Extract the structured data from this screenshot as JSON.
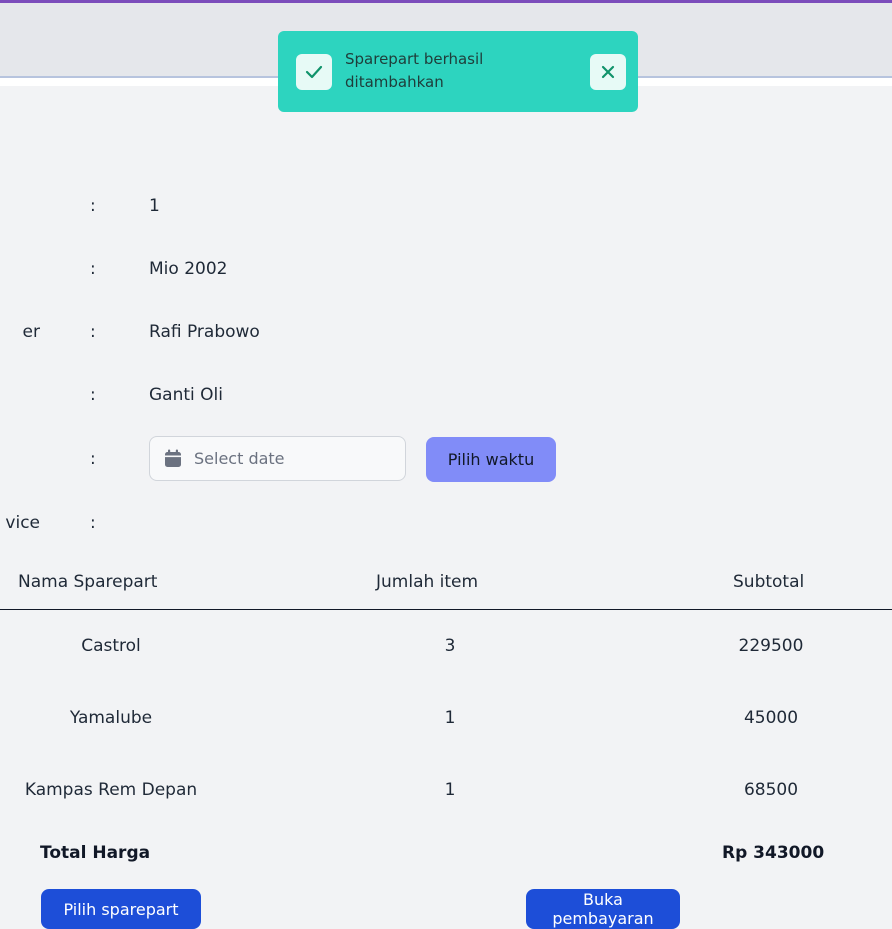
{
  "toast": {
    "message": "Sparepart berhasil ditambahkan",
    "icon": "check-icon",
    "close_icon": "close-icon",
    "color": "#2dd4bf"
  },
  "details": [
    {
      "label": "",
      "value": "1"
    },
    {
      "label": "",
      "value": "Mio 2002"
    },
    {
      "label": "er",
      "value": "Rafi Prabowo"
    },
    {
      "label": "",
      "value": "Ganti Oli"
    },
    {
      "label": "",
      "value": ""
    },
    {
      "label": "vice",
      "value": ""
    }
  ],
  "separator": ":",
  "date_input": {
    "placeholder": "Select date",
    "icon": "calendar-icon"
  },
  "pick_time_button": "Pilih waktu",
  "table": {
    "headers": [
      "Nama Sparepart",
      "Jumlah item",
      "Subtotal"
    ],
    "rows": [
      {
        "name": "Castrol",
        "qty": "3",
        "subtotal": "229500"
      },
      {
        "name": "Yamalube",
        "qty": "1",
        "subtotal": "45000"
      },
      {
        "name": "Kampas Rem Depan",
        "qty": "1",
        "subtotal": "68500"
      }
    ]
  },
  "total": {
    "label": "Total Harga",
    "value": "Rp 343000"
  },
  "buttons": {
    "left": "Pilih sparepart",
    "right": "Buka pembayaran"
  }
}
